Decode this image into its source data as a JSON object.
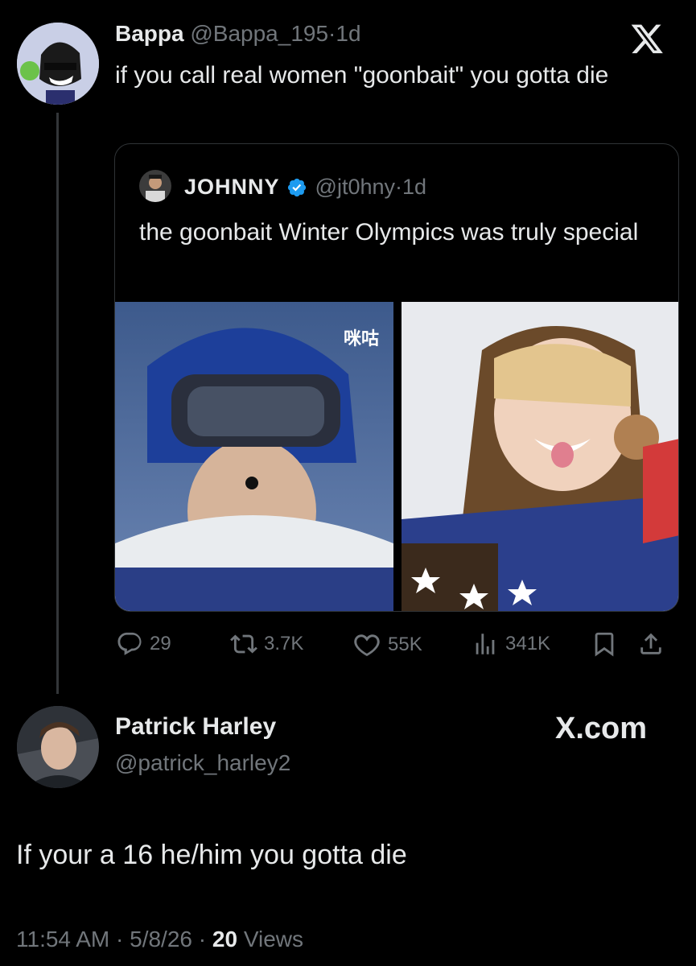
{
  "tweet": {
    "author_name": "Bappa",
    "handle": "@Bappa_195",
    "separator": "·",
    "time": "1d",
    "text": "if you call real women \"goonbait\" you gotta die"
  },
  "quote": {
    "author_name": "JOHNNY",
    "handle": "@jt0hny",
    "separator": "·",
    "time": "1d",
    "text": "the goonbait Winter Olympics was truly special",
    "image1_watermark": "咪咕"
  },
  "actions": {
    "replies": "29",
    "reposts": "3.7K",
    "likes": "55K",
    "views": "341K"
  },
  "reply": {
    "author_name": "Patrick Harley",
    "handle": "@patrick_harley2",
    "brand": "X.com",
    "text": "If your a 16 he/him you gotta die",
    "time": "11:54 AM",
    "separator": "·",
    "date": "5/8/26",
    "views_count": "20",
    "views_label": "Views"
  },
  "icons": [
    "x-logo-icon",
    "verified-badge-icon",
    "reply-icon",
    "repost-icon",
    "like-icon",
    "views-icon",
    "bookmark-icon",
    "share-icon"
  ],
  "colors": {
    "background": "#000000",
    "text": "#e7e9ea",
    "muted": "#71767b",
    "verified": "#1d9bf0",
    "border": "#2f3336"
  }
}
